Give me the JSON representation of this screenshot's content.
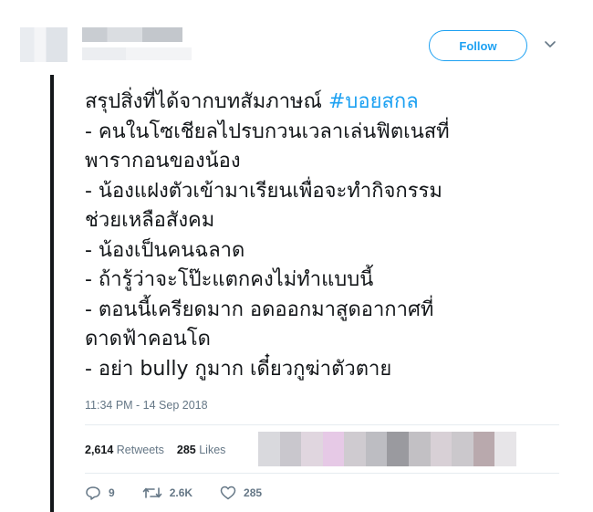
{
  "header": {
    "follow_label": "Follow"
  },
  "tweet": {
    "text_pre": "สรุปสิ่งที่ได้จากบทสัมภาษณ์ ",
    "hashtag": "#บอยสกล",
    "text_body": "- คนในโซเชียลไปรบกวนเวลาเล่นฟิตเนสที่\nพารากอนของน้อง\n- น้องแฝงตัวเข้ามาเรียนเพื่อจะทำกิจกรรม\nช่วยเหลือสังคม\n- น้องเป็นคนฉลาด\n- ถ้ารู้ว่าจะโป๊ะแตกคงไม่ทำแบบนี้\n- ตอนนี้เครียดมาก อดออกมาสูดอากาศที่\nดาดฟ้าคอนโด\n- อย่า bully กูมาก เดี๋ยวกูฆ่าตัวตาย",
    "timestamp": "11:34 PM - 14 Sep 2018"
  },
  "stats": {
    "retweets_count": "2,614",
    "retweets_label": "Retweets",
    "likes_count": "285",
    "likes_label": "Likes"
  },
  "actions": {
    "replies": "9",
    "retweets": "2.6K",
    "likes": "285"
  },
  "colors": {
    "accent": "#1da1f2",
    "muted": "#657786"
  }
}
